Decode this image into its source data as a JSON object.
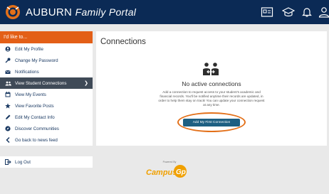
{
  "header": {
    "brand_main": "AUBURN",
    "brand_sub": "Family Portal",
    "icons": [
      "id-card-icon",
      "graduation-cap-icon",
      "bell-icon",
      "user-icon"
    ],
    "colors": {
      "bar": "#0b2a55",
      "accent": "#e35f17"
    }
  },
  "sidebar": {
    "heading": "I'd like to...",
    "items": [
      {
        "label": "Edit My Profile",
        "icon": "user-circle-icon"
      },
      {
        "label": "Change My Password",
        "icon": "key-icon"
      },
      {
        "label": "Notifications",
        "icon": "envelope-icon"
      },
      {
        "label": "View Student Connections",
        "icon": "users-icon",
        "active": true
      },
      {
        "label": "View My Events",
        "icon": "calendar-icon"
      },
      {
        "label": "View Favorite Posts",
        "icon": "star-icon"
      },
      {
        "label": "Edit My Contact Info",
        "icon": "pencil-icon"
      },
      {
        "label": "Discover Communities",
        "icon": "compass-icon"
      },
      {
        "label": "Go back to news feed",
        "icon": "chevron-left-icon"
      }
    ],
    "logout": "Log Out"
  },
  "main": {
    "title": "Connections",
    "empty_title": "No active connections",
    "empty_desc": "Add a connection to request access to your student's academic and financial records. You'll be notified anytime their records are updated, in order to help them stay on track! You can update your connection request at any time.",
    "button": "Add My First Connection"
  },
  "footer": {
    "powered_by": "Powered By",
    "brand": "CampusGroups"
  }
}
